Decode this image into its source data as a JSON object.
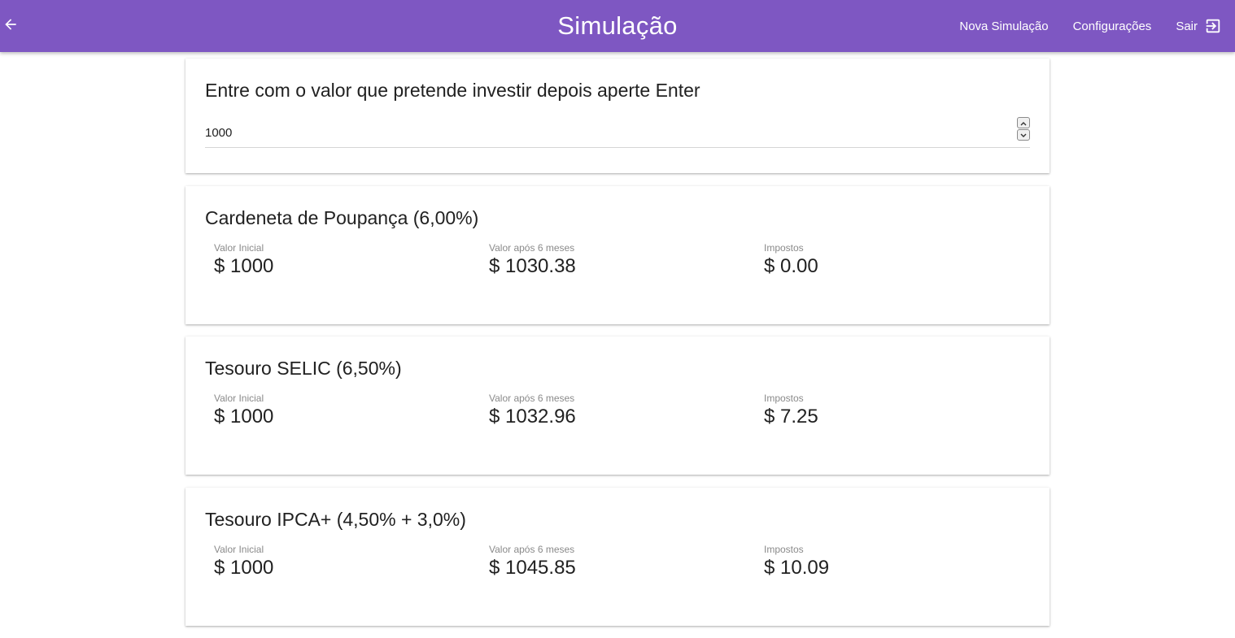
{
  "header": {
    "title": "Simulação",
    "back_icon": "arrow-left-icon",
    "nova_simulacao_label": "Nova Simulação",
    "configuracoes_label": "Configurações",
    "sair_label": "Sair",
    "sair_icon": "exit-to-app-icon",
    "background_color": "#7e57c2"
  },
  "input_card": {
    "title": "Entre com o valor que pretende investir depois aperte Enter",
    "value": "1000"
  },
  "investments": [
    {
      "title": "Cardeneta de Poupança (6,00%)",
      "initial_label": "Valor Inicial",
      "initial_value": "$ 1000",
      "after_label": "Valor após 6 meses",
      "after_value": "$ 1030.38",
      "tax_label": "Impostos",
      "tax_value": "$ 0.00"
    },
    {
      "title": "Tesouro SELIC (6,50%)",
      "initial_label": "Valor Inicial",
      "initial_value": "$ 1000",
      "after_label": "Valor após 6 meses",
      "after_value": "$ 1032.96",
      "tax_label": "Impostos",
      "tax_value": "$ 7.25"
    },
    {
      "title": "Tesouro IPCA+ (4,50% + 3,0%)",
      "initial_label": "Valor Inicial",
      "initial_value": "$ 1000",
      "after_label": "Valor após 6 meses",
      "after_value": "$ 1045.85",
      "tax_label": "Impostos",
      "tax_value": "$ 10.09"
    }
  ]
}
